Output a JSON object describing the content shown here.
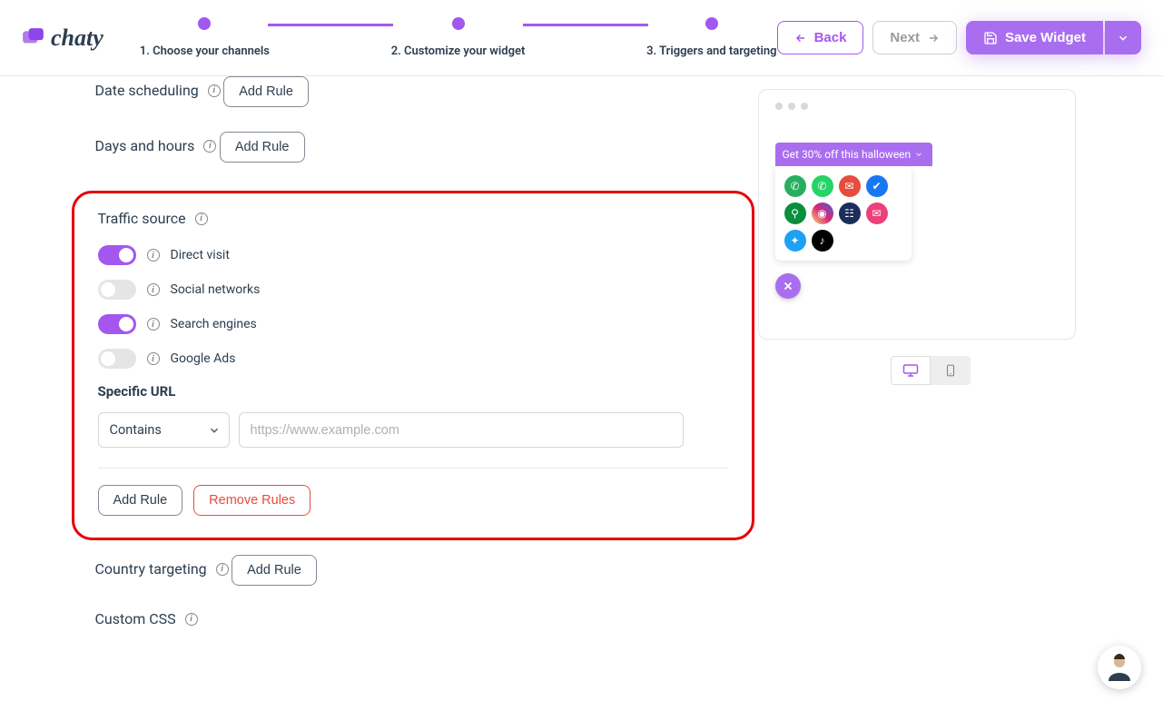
{
  "brand": {
    "name": "chaty"
  },
  "steps": [
    {
      "label": "1. Choose your channels"
    },
    {
      "label": "2. Customize your widget"
    },
    {
      "label": "3. Triggers and targeting"
    }
  ],
  "header": {
    "back": "Back",
    "next": "Next",
    "save": "Save Widget"
  },
  "sections": {
    "date_scheduling": {
      "title": "Date scheduling",
      "add_rule": "Add Rule"
    },
    "days_hours": {
      "title": "Days and hours",
      "add_rule": "Add Rule"
    },
    "traffic_source": {
      "title": "Traffic source",
      "options": [
        {
          "label": "Direct visit",
          "on": true
        },
        {
          "label": "Social networks",
          "on": false
        },
        {
          "label": "Search engines",
          "on": true
        },
        {
          "label": "Google Ads",
          "on": false
        }
      ],
      "specific_url_heading": "Specific URL",
      "select_value": "Contains",
      "url_placeholder": "https://www.example.com",
      "url_value": "",
      "add_rule": "Add Rule",
      "remove_rules": "Remove Rules"
    },
    "country": {
      "title": "Country targeting",
      "add_rule": "Add Rule"
    },
    "custom_css": {
      "title": "Custom CSS"
    }
  },
  "preview": {
    "promo": "Get 30% off this halloween",
    "channels": [
      {
        "name": "phone",
        "bg": "#27ae60"
      },
      {
        "name": "whatsapp",
        "bg": "#25d366"
      },
      {
        "name": "email",
        "bg": "#e74c3c"
      },
      {
        "name": "messenger",
        "bg": "#1877f2"
      },
      {
        "name": "maps",
        "bg": "#0a8f3c"
      },
      {
        "name": "instagram",
        "bg": "linear-gradient(45deg,#feda75,#d62976,#4f5bd5)"
      },
      {
        "name": "contact",
        "bg": "#1b2d5b"
      },
      {
        "name": "sms",
        "bg": "#ec407a"
      },
      {
        "name": "twitter",
        "bg": "#1da1f2"
      },
      {
        "name": "tiktok",
        "bg": "#000000"
      }
    ]
  }
}
